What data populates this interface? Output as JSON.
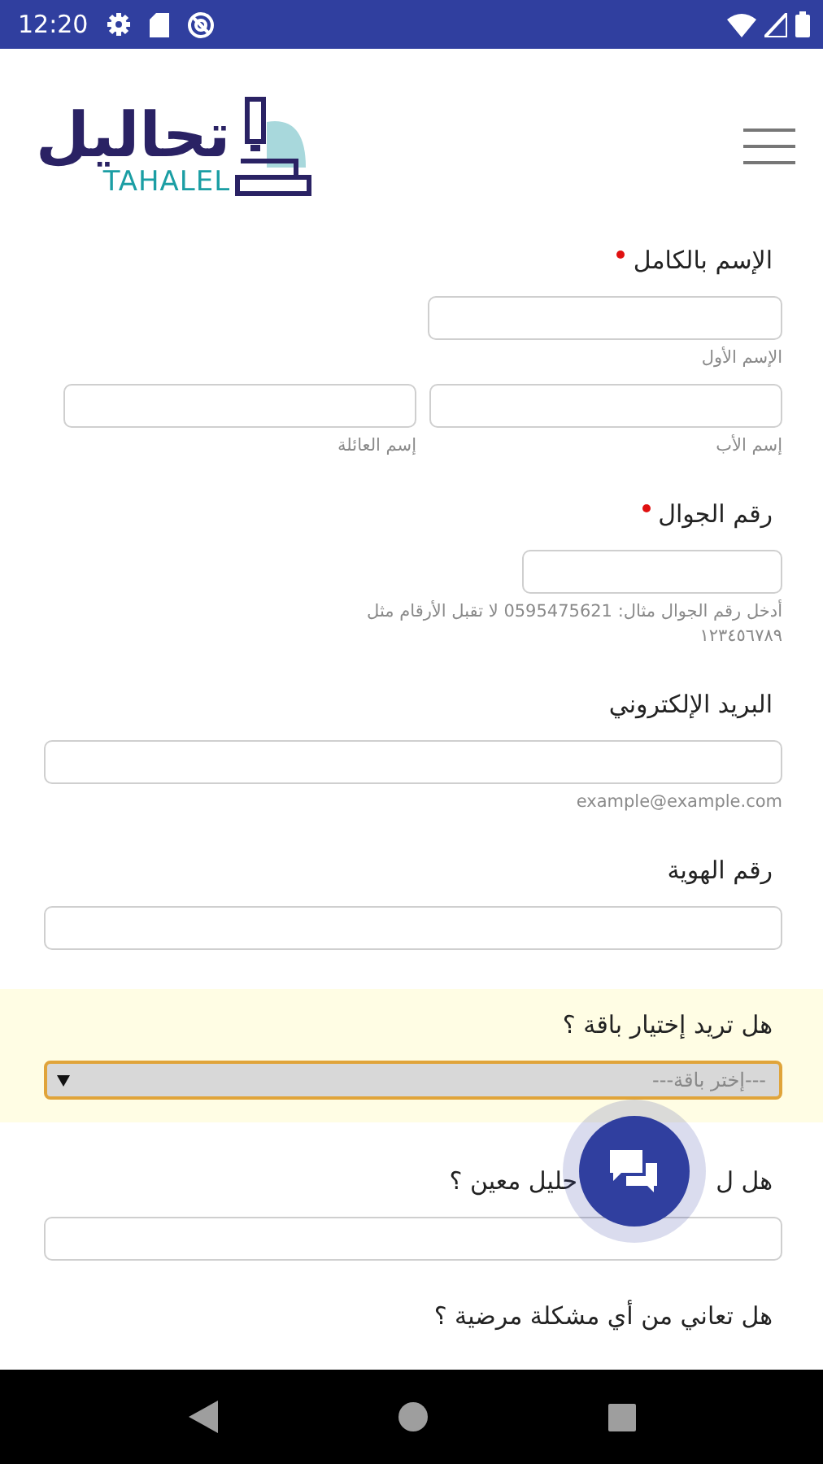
{
  "status_bar": {
    "time": "12:20"
  },
  "header": {
    "logo_arabic": "تحاليل",
    "logo_latin": "TAHALEL"
  },
  "form": {
    "fields": [
      {
        "kind": "name",
        "label": "الإسم بالكامل",
        "required": true,
        "parts": [
          {
            "hint": "الإسم الأول"
          },
          {
            "hint": "إسم الأب"
          },
          {
            "hint": "إسم العائلة"
          }
        ]
      },
      {
        "kind": "short_input",
        "label": "رقم الجوال",
        "required": true,
        "hint": "أدخل رقم الجوال مثال: 0595475621 لا تقبل الأرقام مثل ١٢٣٤٥٦٧٨٩"
      },
      {
        "kind": "input",
        "label": "البريد الإلكتروني",
        "required": false,
        "hint": "example@example.com"
      },
      {
        "kind": "input",
        "label": "رقم الهوية",
        "required": false
      },
      {
        "kind": "select",
        "label": "هل تريد إختيار باقة ؟",
        "required": false,
        "highlighted": true,
        "value": "---إختر باقة---"
      },
      {
        "kind": "input",
        "label_parts": [
          "هل ل",
          "حليل معين ؟"
        ],
        "required": false,
        "covered": true
      },
      {
        "kind": "label_only",
        "label": "هل تعاني من أي مشكلة مرضية ؟",
        "required": false
      }
    ]
  }
}
